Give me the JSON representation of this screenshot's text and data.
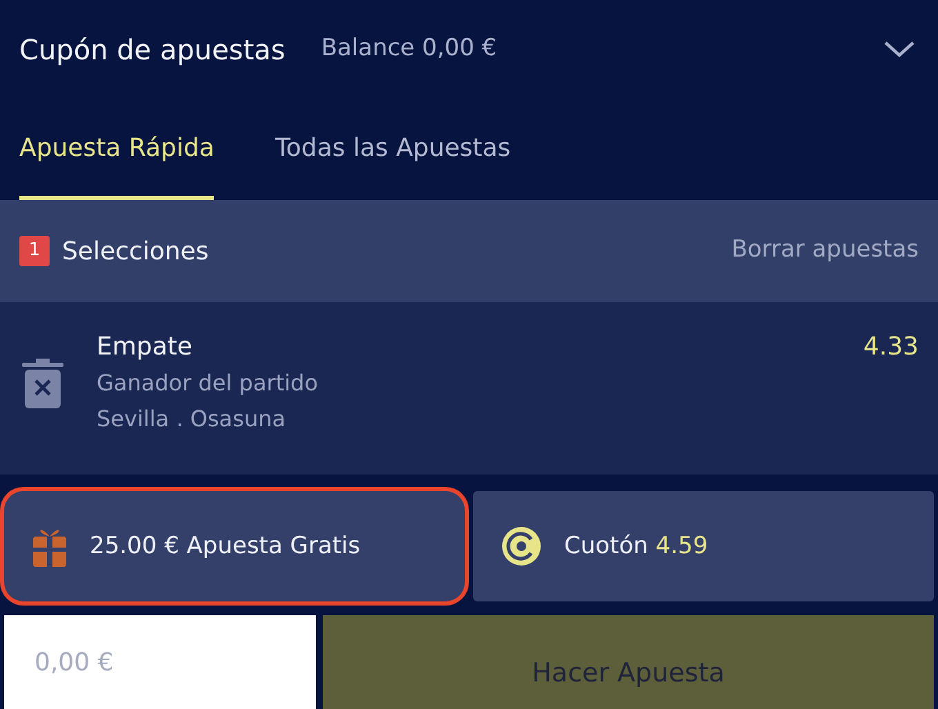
{
  "header": {
    "title": "Cupón de apuestas",
    "balance": "Balance 0,00 €",
    "expanded": true
  },
  "tabs": [
    {
      "label": "Apuesta Rápida",
      "selected": true
    },
    {
      "label": "Todas las Apuestas",
      "selected": false
    }
  ],
  "selections_bar": {
    "count": "1",
    "label": "Selecciones",
    "clear": "Borrar apuestas"
  },
  "selections": [
    {
      "pick": "Empate",
      "market": "Ganador del partido",
      "event": "Sevilla . Osasuna",
      "odds": "4.33"
    }
  ],
  "promos": [
    {
      "kind": "freebet",
      "text": "25.00 € Apuesta Gratis",
      "highlighted": true
    },
    {
      "kind": "boost",
      "text": "Cuotón",
      "odds": "4.59",
      "highlighted": false
    }
  ],
  "stake": {
    "placeholder": "0,00 €"
  },
  "place_button": "Hacer Apuesta"
}
